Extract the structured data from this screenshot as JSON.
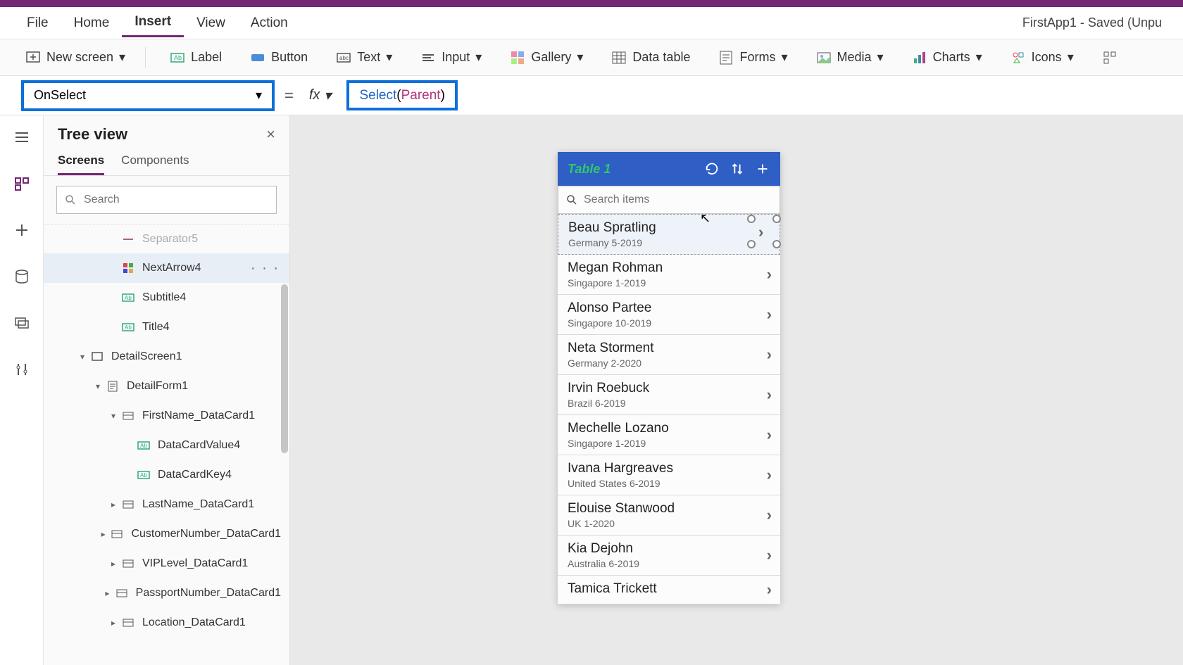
{
  "app": {
    "save_status": "FirstApp1 - Saved (Unpu"
  },
  "menu": {
    "file": "File",
    "home": "Home",
    "insert": "Insert",
    "view": "View",
    "action": "Action"
  },
  "ribbon": {
    "new_screen": "New screen",
    "label": "Label",
    "button": "Button",
    "text": "Text",
    "input": "Input",
    "gallery": "Gallery",
    "data_table": "Data table",
    "forms": "Forms",
    "media": "Media",
    "charts": "Charts",
    "icons": "Icons"
  },
  "formula": {
    "property": "OnSelect",
    "equals": "=",
    "fx": "fx",
    "expr_kw": "Select",
    "expr_open": "(",
    "expr_arg": "Parent",
    "expr_close": ")"
  },
  "tree": {
    "title": "Tree view",
    "tabs": {
      "screens": "Screens",
      "components": "Components"
    },
    "search_placeholder": "Search",
    "items": [
      {
        "label": "Separator5",
        "indent": 3,
        "icon": "separator",
        "caret": "",
        "truncated": true
      },
      {
        "label": "NextArrow4",
        "indent": 3,
        "icon": "icon-control",
        "caret": "",
        "selected": true,
        "menu": true
      },
      {
        "label": "Subtitle4",
        "indent": 3,
        "icon": "label",
        "caret": ""
      },
      {
        "label": "Title4",
        "indent": 3,
        "icon": "label",
        "caret": ""
      },
      {
        "label": "DetailScreen1",
        "indent": 1,
        "icon": "screen",
        "caret": "▾"
      },
      {
        "label": "DetailForm1",
        "indent": 2,
        "icon": "form",
        "caret": "▾"
      },
      {
        "label": "FirstName_DataCard1",
        "indent": 3,
        "icon": "card",
        "caret": "▾"
      },
      {
        "label": "DataCardValue4",
        "indent": 4,
        "icon": "label",
        "caret": ""
      },
      {
        "label": "DataCardKey4",
        "indent": 4,
        "icon": "label",
        "caret": ""
      },
      {
        "label": "LastName_DataCard1",
        "indent": 3,
        "icon": "card",
        "caret": "▸"
      },
      {
        "label": "CustomerNumber_DataCard1",
        "indent": 3,
        "icon": "card",
        "caret": "▸"
      },
      {
        "label": "VIPLevel_DataCard1",
        "indent": 3,
        "icon": "card",
        "caret": "▸"
      },
      {
        "label": "PassportNumber_DataCard1",
        "indent": 3,
        "icon": "card",
        "caret": "▸"
      },
      {
        "label": "Location_DataCard1",
        "indent": 3,
        "icon": "card",
        "caret": "▸"
      }
    ]
  },
  "phone": {
    "title": "Table 1",
    "search_placeholder": "Search items",
    "rows": [
      {
        "title": "Beau Spratling",
        "sub": "Germany 5-2019"
      },
      {
        "title": "Megan Rohman",
        "sub": "Singapore 1-2019"
      },
      {
        "title": "Alonso Partee",
        "sub": "Singapore 10-2019"
      },
      {
        "title": "Neta Storment",
        "sub": "Germany 2-2020"
      },
      {
        "title": "Irvin Roebuck",
        "sub": "Brazil 6-2019"
      },
      {
        "title": "Mechelle Lozano",
        "sub": "Singapore 1-2019"
      },
      {
        "title": "Ivana Hargreaves",
        "sub": "United States 6-2019"
      },
      {
        "title": "Elouise Stanwood",
        "sub": "UK 1-2020"
      },
      {
        "title": "Kia Dejohn",
        "sub": "Australia 6-2019"
      },
      {
        "title": "Tamica Trickett",
        "sub": ""
      }
    ]
  }
}
